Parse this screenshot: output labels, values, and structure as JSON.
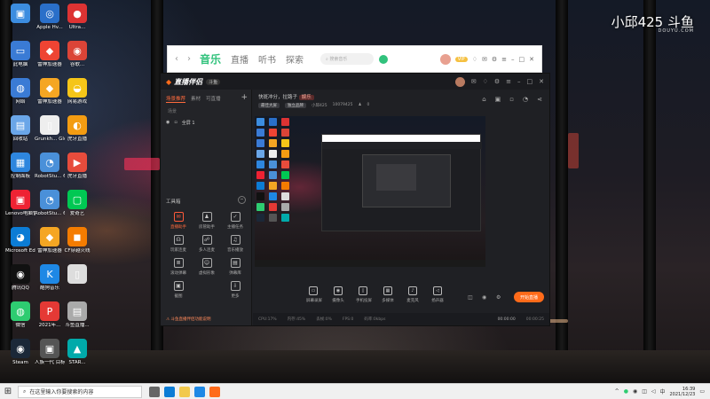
{
  "watermark": {
    "streamer": "小邱425",
    "site_logo": "斗鱼",
    "site_url": "DOUYU.COM"
  },
  "desktop_icons": [
    {
      "label": "",
      "color": "#3c8de0",
      "glyph": "▣"
    },
    {
      "label": "Apple Hv...",
      "color": "#2a6fc9",
      "glyph": "◎"
    },
    {
      "label": "Ultra...",
      "color": "#d33",
      "glyph": "●"
    },
    {
      "label": "此电脑",
      "color": "#3a7bd5",
      "glyph": "▭"
    },
    {
      "label": "雷神加速器",
      "color": "#e43",
      "glyph": "◆"
    },
    {
      "label": "谷歌...",
      "color": "#db4437",
      "glyph": "◉"
    },
    {
      "label": "网络",
      "color": "#3a7bd5",
      "glyph": "◍"
    },
    {
      "label": "雷神加速器",
      "color": "#f5a623",
      "glyph": "◆"
    },
    {
      "label": "网易游戏",
      "color": "#f5c518",
      "glyph": "◒"
    },
    {
      "label": "回收站",
      "color": "#6aa6e8",
      "glyph": "▤"
    },
    {
      "label": "Grunkh... Global Off...",
      "color": "#eee",
      "glyph": "▯"
    },
    {
      "label": "虎牙直播",
      "color": "#f39c12",
      "glyph": "◐"
    },
    {
      "label": "控制面板",
      "color": "#2e86de",
      "glyph": "▦"
    },
    {
      "label": "RobotStu... 6.04.01",
      "color": "#4a90d9",
      "glyph": "◔"
    },
    {
      "label": "虎牙直播",
      "color": "#e74c3c",
      "glyph": "▶"
    },
    {
      "label": "Lenovo电脑管家",
      "color": "#e23",
      "glyph": "▣"
    },
    {
      "label": "RobotStu... 6.04.01",
      "color": "#4a90d9",
      "glyph": "◔"
    },
    {
      "label": "爱奇艺",
      "color": "#00c853",
      "glyph": "▢"
    },
    {
      "label": "Microsoft Edge",
      "color": "#0c7cd5",
      "glyph": "◕"
    },
    {
      "label": "雷神加速器",
      "color": "#f5a623",
      "glyph": "◆"
    },
    {
      "label": "CF穿越火线",
      "color": "#f57c00",
      "glyph": "◼"
    },
    {
      "label": "腾讯QQ",
      "color": "#111",
      "glyph": "◉"
    },
    {
      "label": "酷狗音乐",
      "color": "#1e88e5",
      "glyph": "K"
    },
    {
      "label": "",
      "color": "#ddd",
      "glyph": "▯"
    },
    {
      "label": "微信",
      "color": "#2ecc71",
      "glyph": "◍"
    },
    {
      "label": "2021年...",
      "color": "#e53935",
      "glyph": "P"
    },
    {
      "label": "斗鱼直播...",
      "color": "#aaa",
      "glyph": "▤"
    },
    {
      "label": "Steam",
      "color": "#1b2838",
      "glyph": "◉"
    },
    {
      "label": "人族一代 目标...",
      "color": "#555",
      "glyph": "▣"
    },
    {
      "label": "STAR...",
      "color": "#0aa",
      "glyph": "▲"
    }
  ],
  "music_window": {
    "tabs": [
      "音乐",
      "直播",
      "听书",
      "探索"
    ],
    "search_placeholder": "搜索音乐",
    "user_badge": "VIP"
  },
  "app": {
    "title": "直播伴侣",
    "badge": "斗鱼",
    "left_tabs": [
      "场景推荐",
      "素材",
      "可直播"
    ],
    "scene_label": "场景",
    "scene_item": "全屏 1",
    "tools_title": "工具箱",
    "tools": [
      {
        "label": "直播助手",
        "glyph": "✉",
        "hot": true
      },
      {
        "label": "房管助手",
        "glyph": "♟",
        "hot": false
      },
      {
        "label": "主播任务",
        "glyph": "✓",
        "hot": false
      },
      {
        "label": "玩家连麦",
        "glyph": "☊",
        "hot": false
      },
      {
        "label": "多人连麦",
        "glyph": "☍",
        "hot": false
      },
      {
        "label": "音乐播放",
        "glyph": "♫",
        "hot": false
      },
      {
        "label": "滚动弹幕",
        "glyph": "≣",
        "hot": false
      },
      {
        "label": "虚拟形象",
        "glyph": "☺",
        "hot": false
      },
      {
        "label": "弹幕库",
        "glyph": "▤",
        "hot": false
      },
      {
        "label": "截图",
        "glyph": "▣",
        "hot": false
      },
      {
        "label": "",
        "glyph": "",
        "hot": false
      },
      {
        "label": "更多",
        "glyph": "⇩",
        "hot": false
      }
    ],
    "footer_notice": "斗鱼直播伴侣功能说明",
    "room_title": "快斑冲分，拉路子",
    "room_tag": "娱乐",
    "meta": [
      "最佳大屏",
      "独立品牌",
      "小邱425",
      "10079425"
    ],
    "meta_count": "0",
    "bottom_tools": [
      {
        "label": "屏幕录屏",
        "glyph": "▭"
      },
      {
        "label": "摄像头",
        "glyph": "◉"
      },
      {
        "label": "手机投屏",
        "glyph": "▯"
      },
      {
        "label": "多媒体",
        "glyph": "▦"
      },
      {
        "label": "麦克风",
        "glyph": "♪"
      },
      {
        "label": "扬声器",
        "glyph": "◁"
      }
    ],
    "live_button": "开始直播",
    "status_items": [
      "CPU:17%",
      "内存:45%",
      "丢帧:0%",
      "FPS:0",
      "码率:0kbps"
    ],
    "time_a": "00:00:00",
    "time_b": "00:00:25"
  },
  "taskbar": {
    "search_placeholder": "在这里输入你要搜索的内容",
    "time": "16:39",
    "date": "2021/12/23"
  }
}
